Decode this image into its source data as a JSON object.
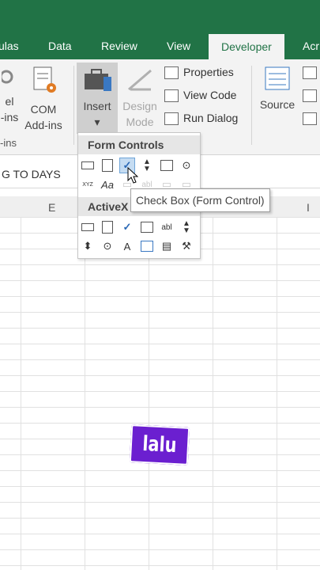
{
  "ribbon_tabs": [
    "ulas",
    "Data",
    "Review",
    "View",
    "Developer",
    "Acr"
  ],
  "ribbon": {
    "excel_addins": [
      "el",
      "-ins"
    ],
    "com_addins": [
      "COM",
      "Add-ins"
    ],
    "group_label": "-ins",
    "insert_label": "Insert",
    "insert_arrow": "▾",
    "design_mode": [
      "Design",
      "Mode"
    ],
    "properties": "Properties",
    "view_code": "View Code",
    "run_dialog": "Run Dialog",
    "source": "Source"
  },
  "name_box": "G TO DAYS",
  "columns": [
    "E",
    "I"
  ],
  "dropdown": {
    "form_controls": "Form Controls",
    "activex": "ActiveX",
    "tooltip": "Check Box (Form Control)",
    "xyz": "XYZ",
    "aa": "Aa",
    "abl": "abl",
    "a": "A"
  },
  "caption": "lalu",
  "colors": {
    "accent": "#217346",
    "caption_bg": "#6b1fd0"
  }
}
